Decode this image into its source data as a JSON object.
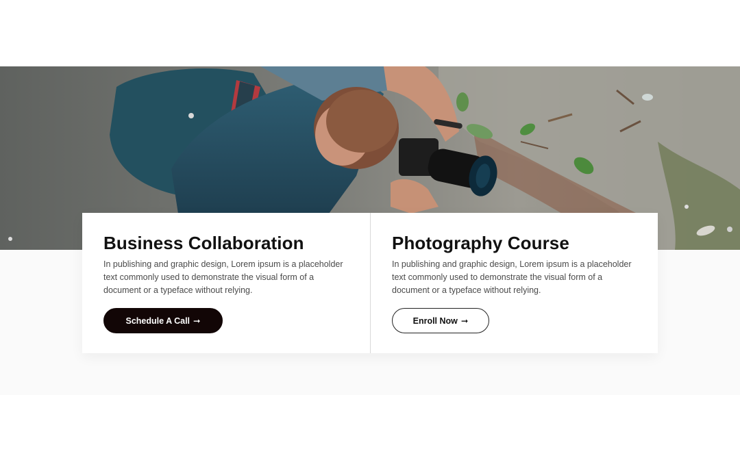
{
  "hero": {
    "image_subject": "photographer crouching with camera on concrete ground",
    "icons": {
      "camera": "camera-icon"
    }
  },
  "cards": [
    {
      "title": "Business Collaboration",
      "text": "In publishing and graphic design, Lorem ipsum is a placeholder text commonly used to demonstrate the visual form of a document or a typeface without relying.",
      "button_label": "Schedule A Call",
      "button_arrow": "➞",
      "button_style": "dark"
    },
    {
      "title": "Photography Course",
      "text": "In publishing and graphic design, Lorem ipsum is a placeholder text commonly used to demonstrate the visual form of a document or a typeface without relying.",
      "button_label": "Enroll Now",
      "button_arrow": "➞",
      "button_style": "outline"
    }
  ],
  "colors": {
    "dark_button": "#120606",
    "title_text": "#111111",
    "body_text": "#4a4a4a",
    "lower_band": "#fafafa"
  }
}
